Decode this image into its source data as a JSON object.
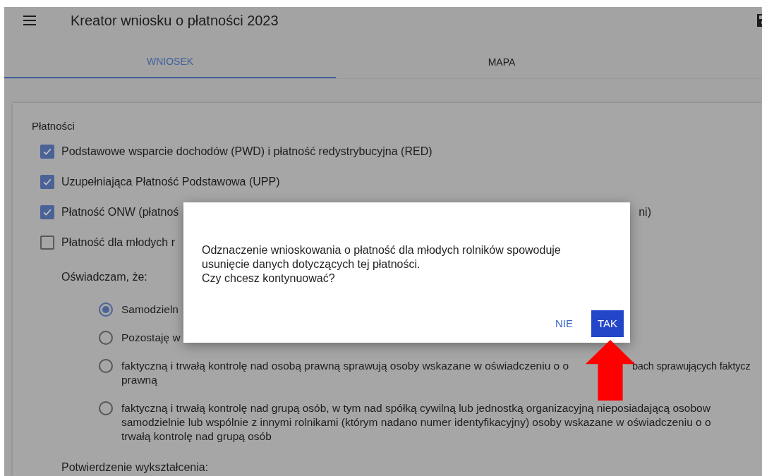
{
  "header": {
    "title": "Kreator wniosku o płatności 2023"
  },
  "tabs": [
    {
      "label": "WNIOSEK",
      "selected": true
    },
    {
      "label": "MAPA",
      "selected": false
    }
  ],
  "section": {
    "title": "Płatności",
    "payments": [
      {
        "label": "Podstawowe wsparcie dochodów (PWD) i płatność redystrybucyjna (RED)",
        "checked": true
      },
      {
        "label": "Uzupełniająca Płatność Podstawowa (UPP)",
        "checked": true
      },
      {
        "label": "Płatność ONW (płatnoś",
        "tail": "ni)",
        "checked": true
      },
      {
        "label": "Płatność dla młodych r",
        "checked": false
      }
    ],
    "declaration": {
      "title": "Oświadczam, że:",
      "options": [
        {
          "lines": [
            "Samodzieln"
          ],
          "selected": true
        },
        {
          "lines": [
            "Pozostaję w"
          ],
          "selected": false
        },
        {
          "lines": [
            "faktyczną i trwałą kontrolę nad osobą prawną sprawują osoby wskazane w oświadczeniu o o",
            "prawną"
          ],
          "line_tail": "bach sprawujących faktycz",
          "selected": false
        },
        {
          "lines": [
            "faktyczną i trwałą kontrolę nad grupą osób, w tym nad spółką cywilną lub jednostką organizacyjną nieposiadającą osobow",
            "samodzielnie lub wspólnie z innymi rolnikami (którym nadano numer identyfikacyjny) osoby wskazane w oświadczeniu o o",
            "trwałą kontrolę nad grupą osób"
          ],
          "selected": false
        }
      ]
    },
    "education_title": "Potwierdzenie wykształcenia:"
  },
  "dialog": {
    "message_lines": [
      "Odznaczenie wnioskowania o płatność dla młodych rolników spowoduje",
      "usunięcie danych dotyczących tej płatności.",
      "Czy chcesz kontynuować?"
    ],
    "buttons": [
      {
        "label": "NIE",
        "kind": "text"
      },
      {
        "label": "TAK",
        "kind": "primary"
      }
    ]
  }
}
